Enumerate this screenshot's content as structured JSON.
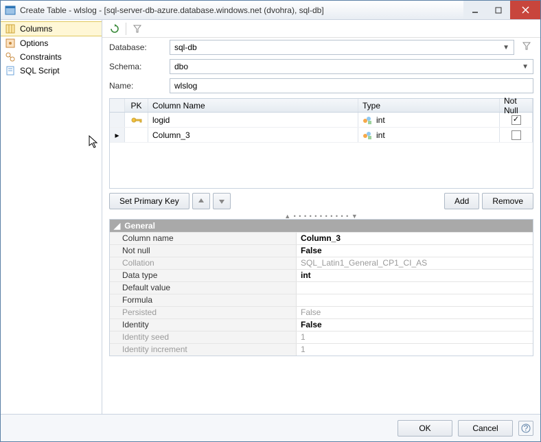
{
  "window": {
    "title": "Create Table - wlslog - [sql-server-db-azure.database.windows.net (dvohra), sql-db]"
  },
  "sidebar": {
    "items": [
      {
        "label": "Columns",
        "selected": true
      },
      {
        "label": "Options"
      },
      {
        "label": "Constraints"
      },
      {
        "label": "SQL Script"
      }
    ]
  },
  "form": {
    "database_label": "Database:",
    "database_value": "sql-db",
    "schema_label": "Schema:",
    "schema_value": "dbo",
    "name_label": "Name:",
    "name_value": "wlslog"
  },
  "grid": {
    "headers": {
      "pk": "PK",
      "name": "Column Name",
      "type": "Type",
      "notnull": "Not Null"
    },
    "rows": [
      {
        "pk": true,
        "name": "logid",
        "type": "int",
        "notnull": true,
        "current": false
      },
      {
        "pk": false,
        "name": "Column_3",
        "type": "int",
        "notnull": false,
        "current": true
      }
    ]
  },
  "midbuttons": {
    "set_pk": "Set Primary Key",
    "add": "Add",
    "remove": "Remove"
  },
  "properties": {
    "heading": "General",
    "rows": [
      {
        "label": "Column name",
        "value": "Column_3",
        "bold": true
      },
      {
        "label": "Not null",
        "value": "False",
        "bold": true
      },
      {
        "label": "Collation",
        "value": "SQL_Latin1_General_CP1_CI_AS",
        "disabled": true
      },
      {
        "label": "Data type",
        "value": "int",
        "bold": true
      },
      {
        "label": "Default value",
        "value": ""
      },
      {
        "label": "Formula",
        "value": ""
      },
      {
        "label": "Persisted",
        "value": "False",
        "disabled": true
      },
      {
        "label": "Identity",
        "value": "False",
        "bold": true
      },
      {
        "label": "Identity seed",
        "value": "1",
        "disabled": true
      },
      {
        "label": "Identity increment",
        "value": "1",
        "disabled": true
      }
    ]
  },
  "bottom": {
    "ok": "OK",
    "cancel": "Cancel"
  }
}
